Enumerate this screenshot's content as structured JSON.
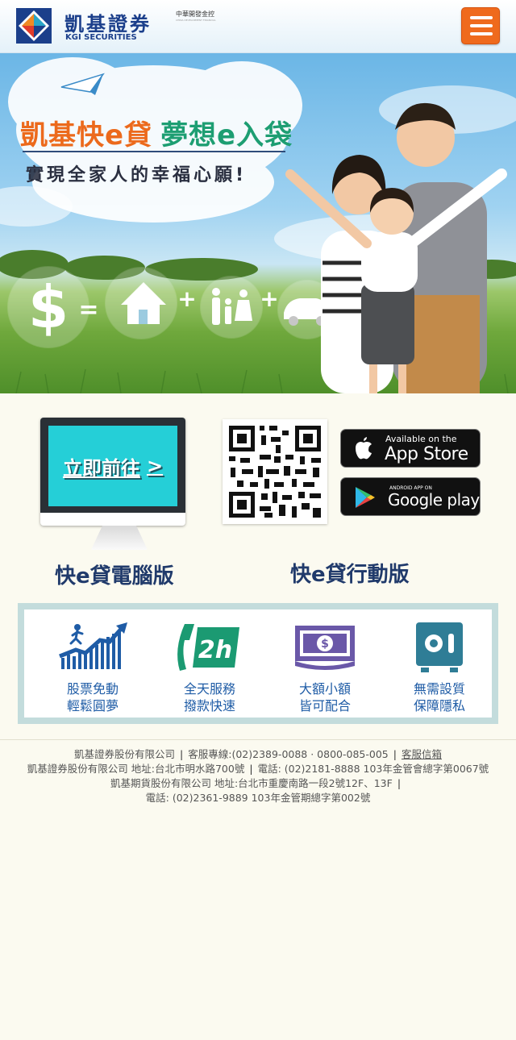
{
  "header": {
    "logo_cn": "凱基證券",
    "logo_en": "KGI SECURITIES",
    "sub_brand": "中華開發金控",
    "sub_brand_en": "CHINA DEVELOPMENT FINANCIAL"
  },
  "banner": {
    "title_part1": "凱基快e貸",
    "title_part2": "夢想e入袋",
    "subtitle": "實現全家人的幸福心願!"
  },
  "download": {
    "pc_button": "立即前往",
    "pc_button_arrow": ">",
    "pc_label": "快e貸電腦版",
    "mobile_label": "快e貸行動版",
    "app_store_small": "Available on the",
    "app_store_big": "App Store",
    "google_small": "ANDROID APP ON",
    "google_big": "Google play"
  },
  "features": [
    {
      "icon": "stock-growth-icon",
      "line1": "股票免動",
      "line2": "輕鬆圓夢"
    },
    {
      "icon": "phone-24h-icon",
      "line1": "全天服務",
      "line2": "撥款快速"
    },
    {
      "icon": "money-bill-icon",
      "line1": "大額小額",
      "line2": "皆可配合"
    },
    {
      "icon": "safe-icon",
      "line1": "無需設質",
      "line2": "保障隱私"
    }
  ],
  "footer": {
    "company1": "凱基證券股份有限公司",
    "hotline": "客服專線:(02)2389-0088 · 0800-085-005",
    "mailbox": "客服信箱",
    "line2_address": "凱基證券股份有限公司 地址:台北市明水路700號",
    "line2_phone": "電話: (02)2181-8888 103年金管會總字第0067號",
    "line3": "凱基期貨股份有限公司 地址:台北市重慶南路一段2號12F、13F",
    "line4": "電話: (02)2361-9889 103年金管期總字第002號"
  },
  "colors": {
    "brand_blue": "#1b3f8b",
    "menu_orange": "#ef6a1d",
    "title_orange": "#ec6a1c",
    "title_green": "#1d9e72",
    "screen_cyan": "#25cfd7",
    "feature_blue": "#1f5ca6"
  }
}
